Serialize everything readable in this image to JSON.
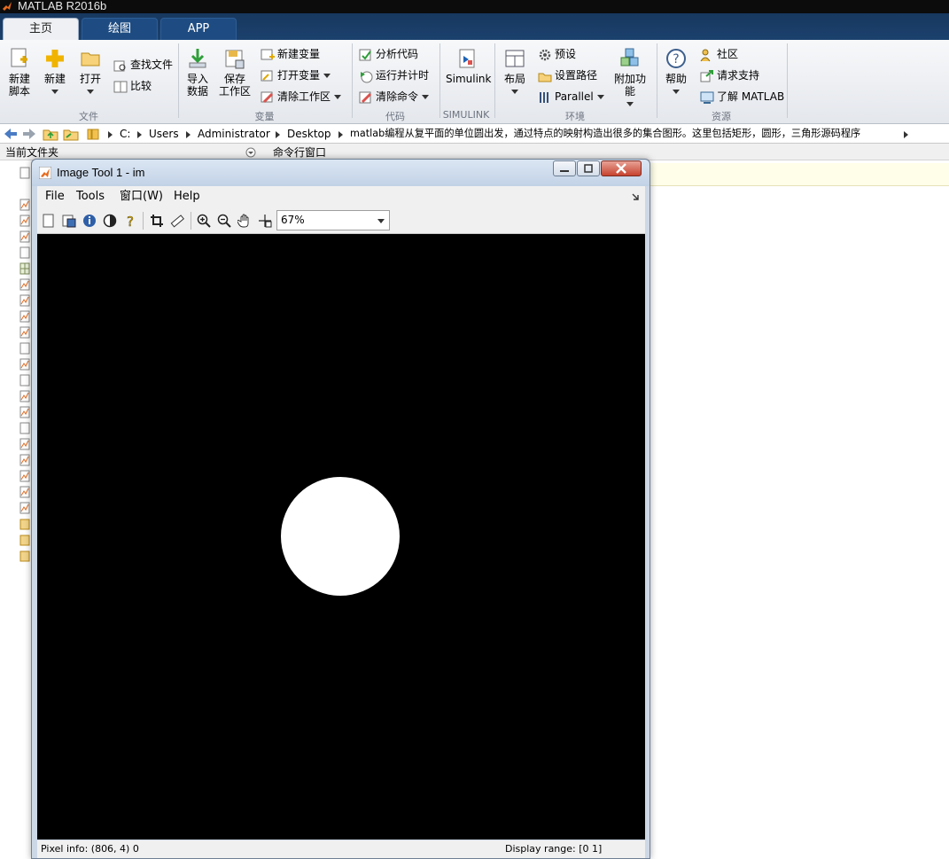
{
  "app": {
    "title": "MATLAB R2016b"
  },
  "tabs": [
    {
      "label": "主页",
      "active": true
    },
    {
      "label": "绘图",
      "active": false
    },
    {
      "label": "APP",
      "active": false
    }
  ],
  "ribbon": {
    "new_script": "新建\n脚本",
    "new": "新建",
    "open": "打开",
    "find_files": "查找文件",
    "compare": "比较",
    "import_data": "导入\n数据",
    "save_workspace": "保存\n工作区",
    "new_variable": "新建变量",
    "open_variable": "打开变量",
    "clear_workspace": "清除工作区",
    "analyze_code": "分析代码",
    "run_and_time": "运行并计时",
    "clear_commands": "清除命令",
    "simulink": "Simulink",
    "layout": "布局",
    "preferences": "预设",
    "set_path": "设置路径",
    "parallel": "Parallel",
    "addons": "附加功能",
    "help": "帮助",
    "community": "社区",
    "request_support": "请求支持",
    "learn_matlab": "了解 MATLAB",
    "groups": {
      "file": "文件",
      "variable": "变量",
      "code": "代码",
      "simulink": "SIMULINK",
      "environment": "环境",
      "resources": "资源"
    }
  },
  "address": {
    "crumbs": [
      "C:",
      "Users",
      "Administrator",
      "Desktop",
      "matlab编程从复平面的单位圆出发，通过特点的映射构造出很多的集合图形。这里包括矩形，圆形，三角形源码程序"
    ]
  },
  "panels": {
    "current_folder": "当前文件夹",
    "command_window": "命令行窗口"
  },
  "image_tool": {
    "title": "Image Tool 1 - im",
    "menu": [
      "File",
      "Tools",
      "窗口(W)",
      "Help"
    ],
    "zoom": "67%",
    "pixel_info": "Pixel info: (806, 4)  0",
    "display_range": "Display range: [0 1]"
  },
  "colors": {
    "tab_strip": "#17385f",
    "canvas_bg": "#000000",
    "circle": "#ffffff"
  },
  "icons": [
    "matlab-logo-icon",
    "new-script-icon",
    "new-icon",
    "open-folder-icon",
    "find-files-icon",
    "compare-icon",
    "import-data-icon",
    "save-workspace-icon",
    "new-variable-icon",
    "open-variable-icon",
    "clear-workspace-icon",
    "analyze-code-icon",
    "run-and-time-icon",
    "clear-commands-icon",
    "simulink-icon",
    "layout-icon",
    "gear-icon",
    "set-path-icon",
    "parallel-icon",
    "addons-icon",
    "help-icon",
    "community-icon",
    "request-support-icon",
    "learn-matlab-icon"
  ]
}
